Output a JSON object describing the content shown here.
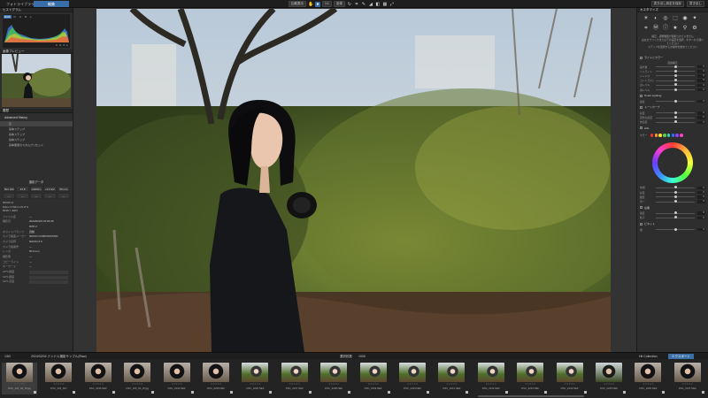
{
  "topbar": {
    "tab_library": "フォトライブラリ",
    "tab_edit": "編集",
    "btn_compare": "比較表示",
    "btn_zoom_label": "1:1",
    "btn_fit": "全体",
    "btn_export_settings": "書き出し設定を保存",
    "btn_export": "書き出し"
  },
  "left": {
    "histogram_title": "ヒストグラム",
    "histo_tabs": [
      "RGB",
      "R",
      "G",
      "B",
      "L"
    ],
    "histo_values": [
      "R",
      "G",
      "B",
      "L"
    ],
    "preview_title": "画像プレビュー",
    "history_title": "履歴",
    "history_group": "Advanced History",
    "history_items": [
      "元",
      "基本ステップ",
      "基本ステップ",
      "基本ステップ",
      "基本使用カスタムプリセット"
    ],
    "camera_title": "撮影データ",
    "camera_cells": [
      "ISO 100",
      "f/1.8",
      "1/2000 s",
      "+0.3 EV",
      "50 mm"
    ],
    "camera_cells2": [
      "—",
      "—",
      "—",
      "—",
      "—"
    ],
    "lens_line_1": "NIKON Z",
    "lens_line_2": "Nikon Z 50mm f/1.8 S",
    "lens_line_3": "6048 × 4024",
    "meta": [
      {
        "k": "ファイル名",
        "v": "—"
      },
      {
        "k": "撮影日",
        "v": "2024/02/04 15:03:26"
      },
      {
        "k": "",
        "v": "DXP-3"
      },
      {
        "k": "ホワイトバランス",
        "v": "自動"
      },
      {
        "k": "カメラ製造メーカー",
        "v": "NIKON CORPORATION"
      },
      {
        "k": "カメラ名称",
        "v": "NIKON Z 6"
      },
      {
        "k": "カメラ製番号",
        "v": "—"
      },
      {
        "k": "レンズ",
        "v": "50.0 mm"
      },
      {
        "k": "撮影者",
        "v": "—"
      },
      {
        "k": "コピーライト",
        "v": "—"
      },
      {
        "k": "キーワード",
        "v": "—"
      }
    ],
    "gps_rows": [
      "GPS 緯度",
      "GPS 経度",
      "GPS 高度"
    ]
  },
  "right": {
    "panel_title": "カスタマイズ",
    "intro_text_1": "補正、調整機能が選択されていません",
    "intro_text_2": "白丸をクリックまたは下の設定を選択、ボタンから開いてください",
    "intro_text_3": "ステップを選択するか操作を始めてください",
    "section_color": "ライトとカラー",
    "section_sub": "自動補正",
    "sliders_a": [
      {
        "name": "露光量",
        "val": "0"
      },
      {
        "name": "ハイライト",
        "val": "0"
      },
      {
        "name": "シャドウ",
        "val": "0"
      },
      {
        "name": "コントラスト",
        "val": "0"
      },
      {
        "name": "白レベル",
        "val": "0"
      },
      {
        "name": "黒レベル",
        "val": "0"
      }
    ],
    "section_smart": "Smart Lighting",
    "sliders_b": [
      {
        "name": "強度",
        "val": "0"
      }
    ],
    "section_curve": "トーンカーブ",
    "sliders_c": [
      {
        "name": "彩度",
        "val": "0"
      },
      {
        "name": "自然な彩度",
        "val": "0"
      },
      {
        "name": "色温度",
        "val": "0"
      }
    ],
    "section_hsl": "HSL",
    "swatch_label": "カラー",
    "swatch_colors": [
      "#ff3030",
      "#ff9a30",
      "#ffe030",
      "#60d040",
      "#30d0c0",
      "#3070ff",
      "#9040ff",
      "#ff40c0"
    ],
    "sliders_d": [
      {
        "name": "色相",
        "val": "0"
      },
      {
        "name": "彩度",
        "val": "0"
      },
      {
        "name": "輝度",
        "val": "0"
      },
      {
        "name": "均一",
        "val": "0"
      }
    ],
    "section_bw": "白黒",
    "sliders_e": [
      {
        "name": "強度",
        "val": "0"
      },
      {
        "name": "粒子",
        "val": "0"
      }
    ],
    "section_vignette": "ビネット",
    "sliders_f": [
      {
        "name": "量",
        "val": "0"
      }
    ]
  },
  "filmstrip": {
    "count_label": "1/83",
    "path_label": "2024/02/04 ナンドル撮影サンプル(Raw)",
    "selected_label": "選択枚数",
    "total_label": "1000",
    "collection_label": "Hit Collection",
    "edit_label": "エクスポート",
    "thumbs": [
      {
        "name": "DSC_223_0A_W.jpg",
        "tone": "dark"
      },
      {
        "name": "DSC_223_0A7",
        "tone": "dark"
      },
      {
        "name": "DSC_2234.NEF",
        "tone": "dark"
      },
      {
        "name": "DSC_223_0A_W.jpg",
        "tone": "dark"
      },
      {
        "name": "DSC_2234.NEF",
        "tone": "dark"
      },
      {
        "name": "DSC_2235.NEF",
        "tone": "dark"
      },
      {
        "name": "DSC_2236.NEF",
        "tone": "green"
      },
      {
        "name": "DSC_2237.NEF",
        "tone": "green"
      },
      {
        "name": "DSC_2238.NEF",
        "tone": "green"
      },
      {
        "name": "DSC_2239.NEF",
        "tone": "green"
      },
      {
        "name": "DSC_2240.NEF",
        "tone": "green"
      },
      {
        "name": "DSC_2241.NEF",
        "tone": "green"
      },
      {
        "name": "DSC_2242.NEF",
        "tone": "green"
      },
      {
        "name": "DSC_2243.NEF",
        "tone": "green"
      },
      {
        "name": "DSC_2244.NEF",
        "tone": "green"
      },
      {
        "name": "DSC_2245.NEF",
        "tone": "mixed"
      },
      {
        "name": "DSC_2246.NEF",
        "tone": "dark"
      },
      {
        "name": "DSC_2247.NEF",
        "tone": "dark"
      },
      {
        "name": "DSC_2248.NEF",
        "tone": "dark"
      }
    ]
  }
}
